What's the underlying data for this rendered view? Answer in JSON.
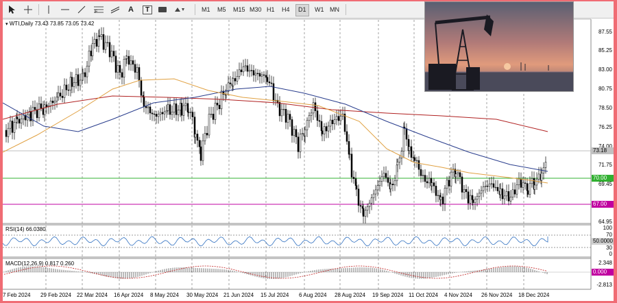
{
  "toolbar": {
    "tools": [
      "cursor-icon",
      "crosshair-icon",
      "vertical-line-icon",
      "horizontal-line-icon",
      "trendline-icon",
      "fibonacci-icon",
      "channel-icon",
      "text-icon",
      "text-label-icon",
      "rectangle-icon",
      "shapes-icon"
    ],
    "text_tool": "A",
    "text_label_tool": "T",
    "timeframes": [
      "M1",
      "M5",
      "M15",
      "M30",
      "H1",
      "H4",
      "D1",
      "W1",
      "MN"
    ],
    "active_timeframe": "D1"
  },
  "chart": {
    "header": "WTI,Daily  73.43 73.85 73.05 73.42",
    "price_levels": [
      "87.55",
      "85.25",
      "83.00",
      "80.75",
      "78.50",
      "76.25",
      "74.00",
      "71.75",
      "69.45",
      "64.95"
    ],
    "current_price": "73.18",
    "level_70": "70.00",
    "level_67": "67.00",
    "dates": [
      "7 Feb 2024",
      "29 Feb 2024",
      "22 Mar 2024",
      "16 Apr 2024",
      "8 May 2024",
      "30 May 2024",
      "21 Jun 2024",
      "15 Jul 2024",
      "6 Aug 2024",
      "28 Aug 2024",
      "19 Sep 2024",
      "11 Oct 2024",
      "4 Nov 2024",
      "26 Nov 2024",
      "18 Dec 2024"
    ]
  },
  "rsi": {
    "label": "RSI(14) 66.0380",
    "levels": [
      "100",
      "70",
      "30",
      "0"
    ],
    "current": "50.0000"
  },
  "macd": {
    "label": "MACD(12,26,9) 0.817 0.260",
    "levels": [
      "2.348",
      "-2.813"
    ],
    "current": "0.000"
  },
  "colors": {
    "frame": "#f06c74",
    "bull": "#ffffff",
    "bear": "#000000",
    "ma_orange": "#e0a040",
    "ma_blue": "#283c8c",
    "ma_red": "#b02020",
    "level_green": "#30b030",
    "level_magenta": "#c000a0",
    "rsi_line": "#3070c0"
  }
}
